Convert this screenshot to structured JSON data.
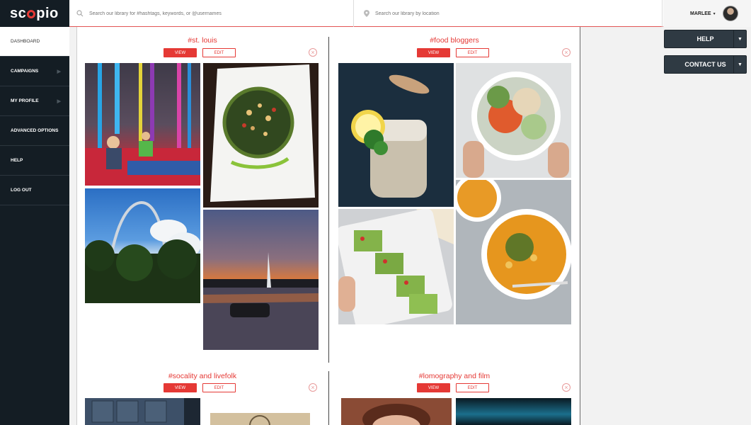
{
  "app": {
    "logo": "sc",
    "logo_end": "pio"
  },
  "search": {
    "placeholder": "Search our library for #hashtags, keywords, or @usernames",
    "location_placeholder": "Search our library by location"
  },
  "user": {
    "name": "MARLEE",
    "caret": "▾"
  },
  "sidebar": {
    "items": [
      {
        "label": "DASHBOARD"
      },
      {
        "label": "CAMPAIGNS"
      },
      {
        "label": "MY PROFILE"
      },
      {
        "label": "ADVANCED OPTIONS"
      },
      {
        "label": "HELP"
      },
      {
        "label": "LOG OUT"
      }
    ]
  },
  "collections": [
    {
      "title": "#st. louis",
      "view": "VIEW",
      "edit": "EDIT"
    },
    {
      "title": "#food bloggers",
      "view": "VIEW",
      "edit": "EDIT"
    },
    {
      "title": "#socality and livefolk",
      "view": "VIEW",
      "edit": "EDIT"
    },
    {
      "title": "#lomography and film",
      "view": "VIEW",
      "edit": "EDIT"
    }
  ],
  "right_buttons": {
    "help": "HELP",
    "contact": "CONTACT US"
  },
  "colors": {
    "accent": "#e53935",
    "sidebar": "#141d24"
  }
}
